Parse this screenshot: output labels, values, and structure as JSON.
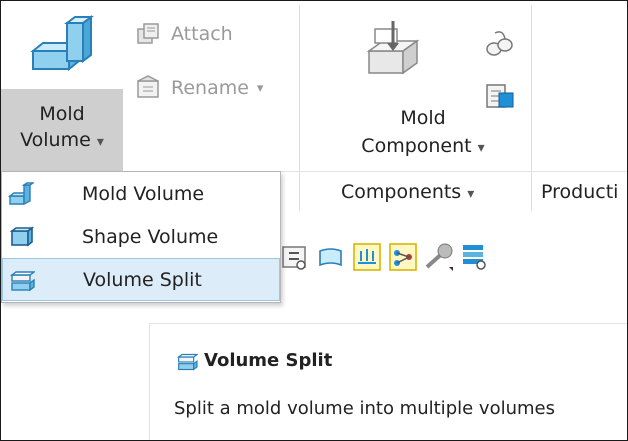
{
  "ribbon": {
    "mold_volume": {
      "line1": "Mold",
      "line2": "Volume",
      "arrow": "▾"
    },
    "attach_label": "Attach",
    "rename_label": "Rename",
    "rename_arrow": "▾",
    "mold_component": {
      "line1": "Mold",
      "line2": "Component",
      "arrow": "▾"
    },
    "groups": {
      "components_label": "Components",
      "components_arrow": "▾",
      "production_label": "Producti"
    }
  },
  "menu": {
    "items": [
      {
        "label": "Mold Volume",
        "icon": "mold-volume-icon"
      },
      {
        "label": "Shape Volume",
        "icon": "shape-volume-icon"
      },
      {
        "label": "Volume Split",
        "icon": "volume-split-icon"
      }
    ]
  },
  "tooltip": {
    "title": "Volume Split",
    "description": "Split a mold volume into multiple volumes"
  },
  "colors": {
    "accent": "#1f8fd6",
    "highlight_bg": "#dcedf9",
    "highlight_border": "#9bc7e6",
    "pressed_bg": "#cfcfcf"
  }
}
